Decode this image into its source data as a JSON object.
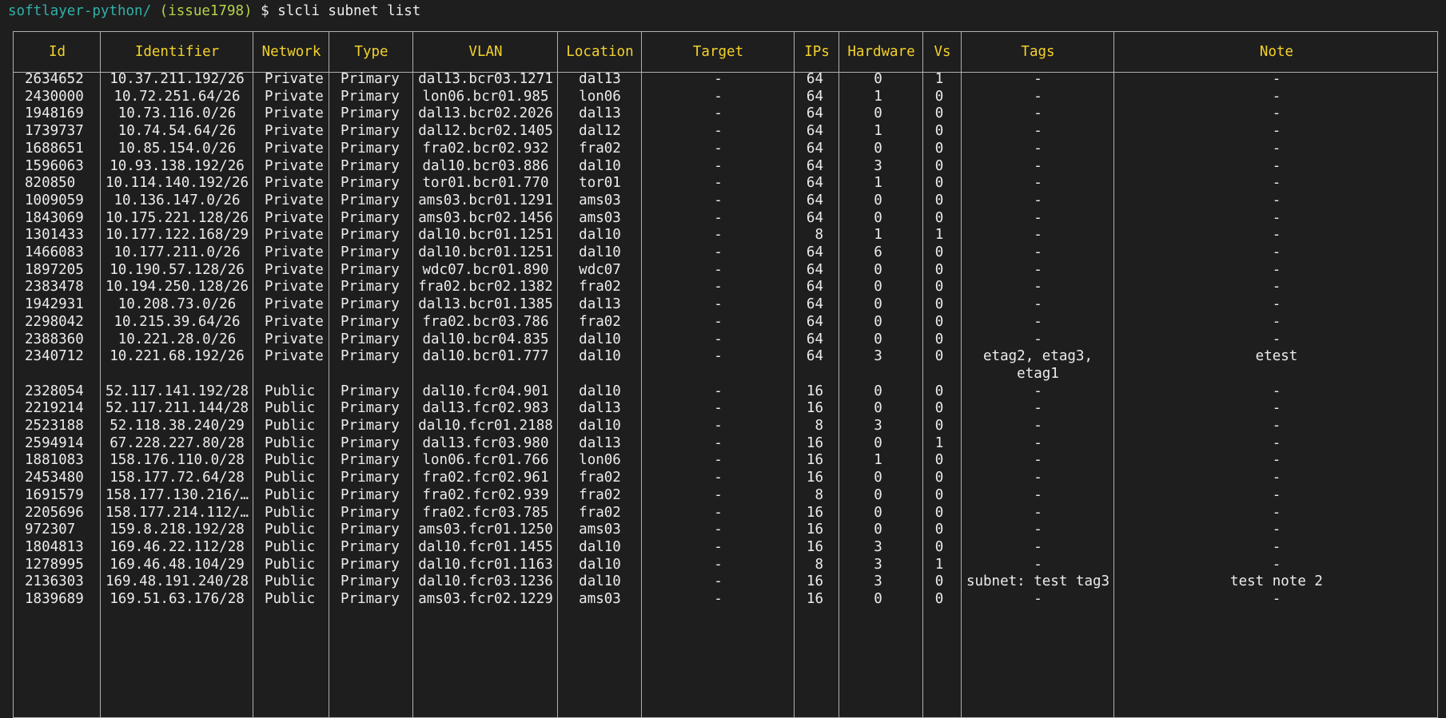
{
  "prompt": {
    "path": "softlayer-python/",
    "branch": "(issue1798)",
    "symbol": "$",
    "command": "slcli subnet list"
  },
  "colors": {
    "background": "#1e1e1e",
    "header_text": "#f2d22b",
    "path": "#2fb1a8",
    "branch": "#b5d34a",
    "text": "#ececec",
    "border": "#b0b0b0"
  },
  "table": {
    "headers": [
      "Id",
      "Identifier",
      "Network",
      "Type",
      "VLAN",
      "Location",
      "Target",
      "IPs",
      "Hardware",
      "Vs",
      "Tags",
      "Note"
    ],
    "rows": [
      {
        "id": "2634652",
        "identifier": "10.37.211.192/26",
        "network": "Private",
        "type": "Primary",
        "vlan": "dal13.bcr03.1271",
        "location": "dal13",
        "target": "-",
        "ips": "64",
        "hardware": "0",
        "vs": "1",
        "tags": "-",
        "note": "-"
      },
      {
        "id": "2430000",
        "identifier": "10.72.251.64/26",
        "network": "Private",
        "type": "Primary",
        "vlan": "lon06.bcr01.985",
        "location": "lon06",
        "target": "-",
        "ips": "64",
        "hardware": "1",
        "vs": "0",
        "tags": "-",
        "note": "-"
      },
      {
        "id": "1948169",
        "identifier": "10.73.116.0/26",
        "network": "Private",
        "type": "Primary",
        "vlan": "dal13.bcr02.2026",
        "location": "dal13",
        "target": "-",
        "ips": "64",
        "hardware": "0",
        "vs": "0",
        "tags": "-",
        "note": "-"
      },
      {
        "id": "1739737",
        "identifier": "10.74.54.64/26",
        "network": "Private",
        "type": "Primary",
        "vlan": "dal12.bcr02.1405",
        "location": "dal12",
        "target": "-",
        "ips": "64",
        "hardware": "1",
        "vs": "0",
        "tags": "-",
        "note": "-"
      },
      {
        "id": "1688651",
        "identifier": "10.85.154.0/26",
        "network": "Private",
        "type": "Primary",
        "vlan": "fra02.bcr02.932",
        "location": "fra02",
        "target": "-",
        "ips": "64",
        "hardware": "0",
        "vs": "0",
        "tags": "-",
        "note": "-"
      },
      {
        "id": "1596063",
        "identifier": "10.93.138.192/26",
        "network": "Private",
        "type": "Primary",
        "vlan": "dal10.bcr03.886",
        "location": "dal10",
        "target": "-",
        "ips": "64",
        "hardware": "3",
        "vs": "0",
        "tags": "-",
        "note": "-"
      },
      {
        "id": "820850",
        "identifier": "10.114.140.192/26",
        "network": "Private",
        "type": "Primary",
        "vlan": "tor01.bcr01.770",
        "location": "tor01",
        "target": "-",
        "ips": "64",
        "hardware": "1",
        "vs": "0",
        "tags": "-",
        "note": "-"
      },
      {
        "id": "1009059",
        "identifier": "10.136.147.0/26",
        "network": "Private",
        "type": "Primary",
        "vlan": "ams03.bcr01.1291",
        "location": "ams03",
        "target": "-",
        "ips": "64",
        "hardware": "0",
        "vs": "0",
        "tags": "-",
        "note": "-"
      },
      {
        "id": "1843069",
        "identifier": "10.175.221.128/26",
        "network": "Private",
        "type": "Primary",
        "vlan": "ams03.bcr02.1456",
        "location": "ams03",
        "target": "-",
        "ips": "64",
        "hardware": "0",
        "vs": "0",
        "tags": "-",
        "note": "-"
      },
      {
        "id": "1301433",
        "identifier": "10.177.122.168/29",
        "network": "Private",
        "type": "Primary",
        "vlan": "dal10.bcr01.1251",
        "location": "dal10",
        "target": "-",
        "ips": "8",
        "hardware": "1",
        "vs": "1",
        "tags": "-",
        "note": "-"
      },
      {
        "id": "1466083",
        "identifier": "10.177.211.0/26",
        "network": "Private",
        "type": "Primary",
        "vlan": "dal10.bcr01.1251",
        "location": "dal10",
        "target": "-",
        "ips": "64",
        "hardware": "6",
        "vs": "0",
        "tags": "-",
        "note": "-"
      },
      {
        "id": "1897205",
        "identifier": "10.190.57.128/26",
        "network": "Private",
        "type": "Primary",
        "vlan": "wdc07.bcr01.890",
        "location": "wdc07",
        "target": "-",
        "ips": "64",
        "hardware": "0",
        "vs": "0",
        "tags": "-",
        "note": "-"
      },
      {
        "id": "2383478",
        "identifier": "10.194.250.128/26",
        "network": "Private",
        "type": "Primary",
        "vlan": "fra02.bcr02.1382",
        "location": "fra02",
        "target": "-",
        "ips": "64",
        "hardware": "0",
        "vs": "0",
        "tags": "-",
        "note": "-"
      },
      {
        "id": "1942931",
        "identifier": "10.208.73.0/26",
        "network": "Private",
        "type": "Primary",
        "vlan": "dal13.bcr01.1385",
        "location": "dal13",
        "target": "-",
        "ips": "64",
        "hardware": "0",
        "vs": "0",
        "tags": "-",
        "note": "-"
      },
      {
        "id": "2298042",
        "identifier": "10.215.39.64/26",
        "network": "Private",
        "type": "Primary",
        "vlan": "fra02.bcr03.786",
        "location": "fra02",
        "target": "-",
        "ips": "64",
        "hardware": "0",
        "vs": "0",
        "tags": "-",
        "note": "-"
      },
      {
        "id": "2388360",
        "identifier": "10.221.28.0/26",
        "network": "Private",
        "type": "Primary",
        "vlan": "dal10.bcr04.835",
        "location": "dal10",
        "target": "-",
        "ips": "64",
        "hardware": "0",
        "vs": "0",
        "tags": "-",
        "note": "-"
      },
      {
        "id": "2340712",
        "identifier": "10.221.68.192/26",
        "network": "Private",
        "type": "Primary",
        "vlan": "dal10.bcr01.777",
        "location": "dal10",
        "target": "-",
        "ips": "64",
        "hardware": "3",
        "vs": "0",
        "tags": "etag2, etag3,",
        "note": "etest"
      },
      {
        "id": "",
        "identifier": "",
        "network": "",
        "type": "",
        "vlan": "",
        "location": "",
        "target": "",
        "ips": "",
        "hardware": "",
        "vs": "",
        "tags": "etag1",
        "note": ""
      },
      {
        "id": "2328054",
        "identifier": "52.117.141.192/28",
        "network": "Public",
        "type": "Primary",
        "vlan": "dal10.fcr04.901",
        "location": "dal10",
        "target": "-",
        "ips": "16",
        "hardware": "0",
        "vs": "0",
        "tags": "-",
        "note": "-"
      },
      {
        "id": "2219214",
        "identifier": "52.117.211.144/28",
        "network": "Public",
        "type": "Primary",
        "vlan": "dal13.fcr02.983",
        "location": "dal13",
        "target": "-",
        "ips": "16",
        "hardware": "0",
        "vs": "0",
        "tags": "-",
        "note": "-"
      },
      {
        "id": "2523188",
        "identifier": "52.118.38.240/29",
        "network": "Public",
        "type": "Primary",
        "vlan": "dal10.fcr01.2188",
        "location": "dal10",
        "target": "-",
        "ips": "8",
        "hardware": "3",
        "vs": "0",
        "tags": "-",
        "note": "-"
      },
      {
        "id": "2594914",
        "identifier": "67.228.227.80/28",
        "network": "Public",
        "type": "Primary",
        "vlan": "dal13.fcr03.980",
        "location": "dal13",
        "target": "-",
        "ips": "16",
        "hardware": "0",
        "vs": "1",
        "tags": "-",
        "note": "-"
      },
      {
        "id": "1881083",
        "identifier": "158.176.110.0/28",
        "network": "Public",
        "type": "Primary",
        "vlan": "lon06.fcr01.766",
        "location": "lon06",
        "target": "-",
        "ips": "16",
        "hardware": "1",
        "vs": "0",
        "tags": "-",
        "note": "-"
      },
      {
        "id": "2453480",
        "identifier": "158.177.72.64/28",
        "network": "Public",
        "type": "Primary",
        "vlan": "fra02.fcr02.961",
        "location": "fra02",
        "target": "-",
        "ips": "16",
        "hardware": "0",
        "vs": "0",
        "tags": "-",
        "note": "-"
      },
      {
        "id": "1691579",
        "identifier": "158.177.130.216/…",
        "network": "Public",
        "type": "Primary",
        "vlan": "fra02.fcr02.939",
        "location": "fra02",
        "target": "-",
        "ips": "8",
        "hardware": "0",
        "vs": "0",
        "tags": "-",
        "note": "-"
      },
      {
        "id": "2205696",
        "identifier": "158.177.214.112/…",
        "network": "Public",
        "type": "Primary",
        "vlan": "fra02.fcr03.785",
        "location": "fra02",
        "target": "-",
        "ips": "16",
        "hardware": "0",
        "vs": "0",
        "tags": "-",
        "note": "-"
      },
      {
        "id": "972307",
        "identifier": "159.8.218.192/28",
        "network": "Public",
        "type": "Primary",
        "vlan": "ams03.fcr01.1250",
        "location": "ams03",
        "target": "-",
        "ips": "16",
        "hardware": "0",
        "vs": "0",
        "tags": "-",
        "note": "-"
      },
      {
        "id": "1804813",
        "identifier": "169.46.22.112/28",
        "network": "Public",
        "type": "Primary",
        "vlan": "dal10.fcr01.1455",
        "location": "dal10",
        "target": "-",
        "ips": "16",
        "hardware": "3",
        "vs": "0",
        "tags": "-",
        "note": "-"
      },
      {
        "id": "1278995",
        "identifier": "169.46.48.104/29",
        "network": "Public",
        "type": "Primary",
        "vlan": "dal10.fcr01.1163",
        "location": "dal10",
        "target": "-",
        "ips": "8",
        "hardware": "3",
        "vs": "1",
        "tags": "-",
        "note": "-"
      },
      {
        "id": "2136303",
        "identifier": "169.48.191.240/28",
        "network": "Public",
        "type": "Primary",
        "vlan": "dal10.fcr03.1236",
        "location": "dal10",
        "target": "-",
        "ips": "16",
        "hardware": "3",
        "vs": "0",
        "tags": "subnet: test tag3",
        "note": "test note 2"
      },
      {
        "id": "1839689",
        "identifier": "169.51.63.176/28",
        "network": "Public",
        "type": "Primary",
        "vlan": "ams03.fcr02.1229",
        "location": "ams03",
        "target": "-",
        "ips": "16",
        "hardware": "0",
        "vs": "0",
        "tags": "-",
        "note": "-"
      }
    ]
  }
}
